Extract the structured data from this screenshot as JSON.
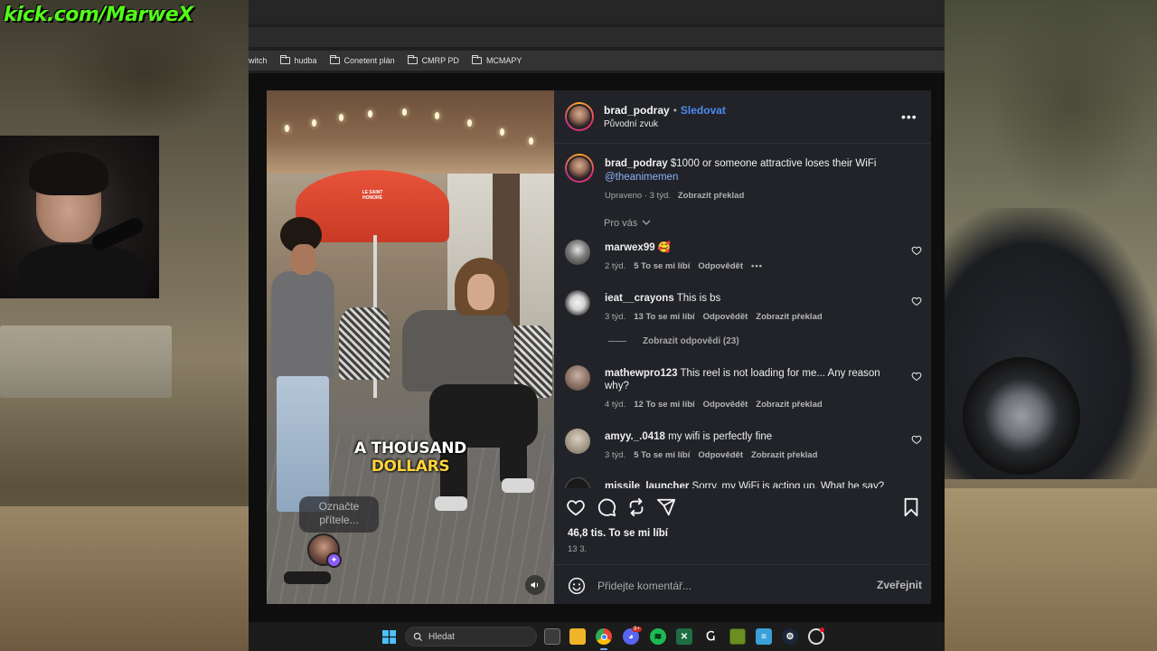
{
  "stream": {
    "kick_label": "kick.com/MarweX"
  },
  "browser": {
    "bookmarks": [
      {
        "label": "witch",
        "folder": false
      },
      {
        "label": "hudba",
        "folder": true
      },
      {
        "label": "Conetent plán",
        "folder": true
      },
      {
        "label": "CMRP PD",
        "folder": true
      },
      {
        "label": "MCMAPY",
        "folder": true
      }
    ]
  },
  "video": {
    "caption_line1": "A THOUSAND",
    "caption_line2": "DOLLARS",
    "tag_prompt": "Označte přítele...",
    "umbrella_text": "LE SAINT HONORÉ"
  },
  "post": {
    "author": "brad_podray",
    "follow_label": "Sledovat",
    "audio": "Původní zvuk",
    "caption_author": "brad_podray",
    "caption_text": "$1000 or someone attractive loses their WiFi",
    "caption_mention": "@theanimemen",
    "caption_meta": "Upraveno · 3 týd.",
    "caption_translate": "Zobrazit překlad",
    "for_you": "Pro vás",
    "likes": "46,8 tis. To se mi líbí",
    "date": "13 3.",
    "comment_placeholder": "Přidejte komentář...",
    "post_button": "Zveřejnit"
  },
  "comments": [
    {
      "user": "marwex99",
      "text": "🥰",
      "age": "2 týd.",
      "likes": "5 To se mi líbí",
      "reply": "Odpovědět",
      "translate": "",
      "has_more": true
    },
    {
      "user": "ieat__crayons",
      "text": "This is bs",
      "age": "3 týd.",
      "likes": "13 To se mi líbí",
      "reply": "Odpovědět",
      "translate": "Zobrazit překlad",
      "has_more": false
    },
    {
      "user": "mathewpro123",
      "text": "This reel is not loading for me... Any reason why?",
      "age": "4 týd.",
      "likes": "12 To se mi líbí",
      "reply": "Odpovědět",
      "translate": "Zobrazit překlad",
      "has_more": false
    },
    {
      "user": "amyy._.0418",
      "text": "my wifi is perfectly fine",
      "age": "3 týd.",
      "likes": "5 To se mi líbí",
      "reply": "Odpovědět",
      "translate": "Zobrazit překlad",
      "has_more": false
    },
    {
      "user": "missile_launcher",
      "text": "Sorry, my WiFi is acting up. What he say?",
      "age": "",
      "likes": "",
      "reply": "",
      "translate": "",
      "has_more": false
    }
  ],
  "replies_toggle": "Zobrazit odpovědi (23)",
  "taskbar": {
    "search_label": "Hledat",
    "discord_badge": "9+"
  },
  "colors": {
    "accent_blue": "#4c8bf5",
    "kick_green": "#53fc18",
    "modal_bg": "#212328"
  },
  "icons": {
    "like": "heart-icon",
    "comment": "comment-icon",
    "share": "repost-icon",
    "send": "send-icon",
    "save": "bookmark-icon",
    "emoji": "emoji-icon",
    "mute": "speaker-icon"
  }
}
